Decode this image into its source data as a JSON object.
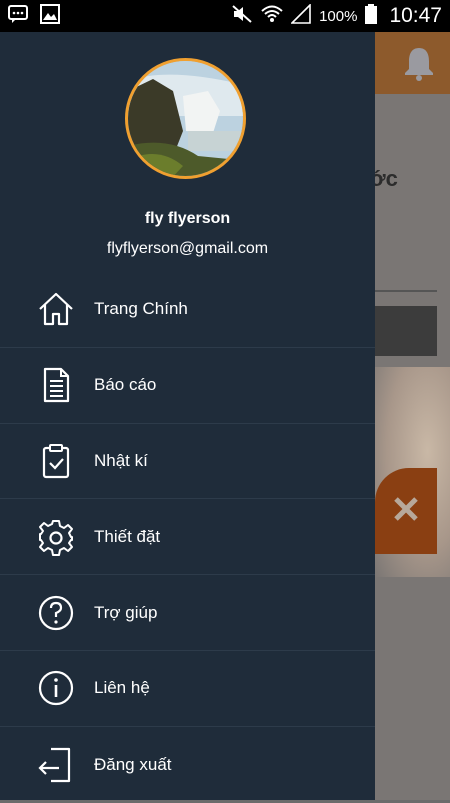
{
  "status_bar": {
    "battery_percent": "100%",
    "time": "10:47"
  },
  "background": {
    "title_fragment": "ớc",
    "accent_color": "#f08a1c"
  },
  "drawer": {
    "user": {
      "name": "fly flyerson",
      "email": "flyflyerson@gmail.com"
    },
    "menu_items": [
      {
        "label": "Trang Chính",
        "icon": "home-icon"
      },
      {
        "label": "Báo cáo",
        "icon": "document-icon"
      },
      {
        "label": "Nhật kí",
        "icon": "clipboard-check-icon"
      },
      {
        "label": "Thiết đặt",
        "icon": "gear-icon"
      },
      {
        "label": "Trợ giúp",
        "icon": "help-icon"
      },
      {
        "label": "Liên hệ",
        "icon": "info-icon"
      },
      {
        "label": "Đăng xuất",
        "icon": "logout-icon"
      }
    ]
  },
  "colors": {
    "drawer_bg": "#1f2c3a",
    "avatar_border": "#f0a030"
  }
}
